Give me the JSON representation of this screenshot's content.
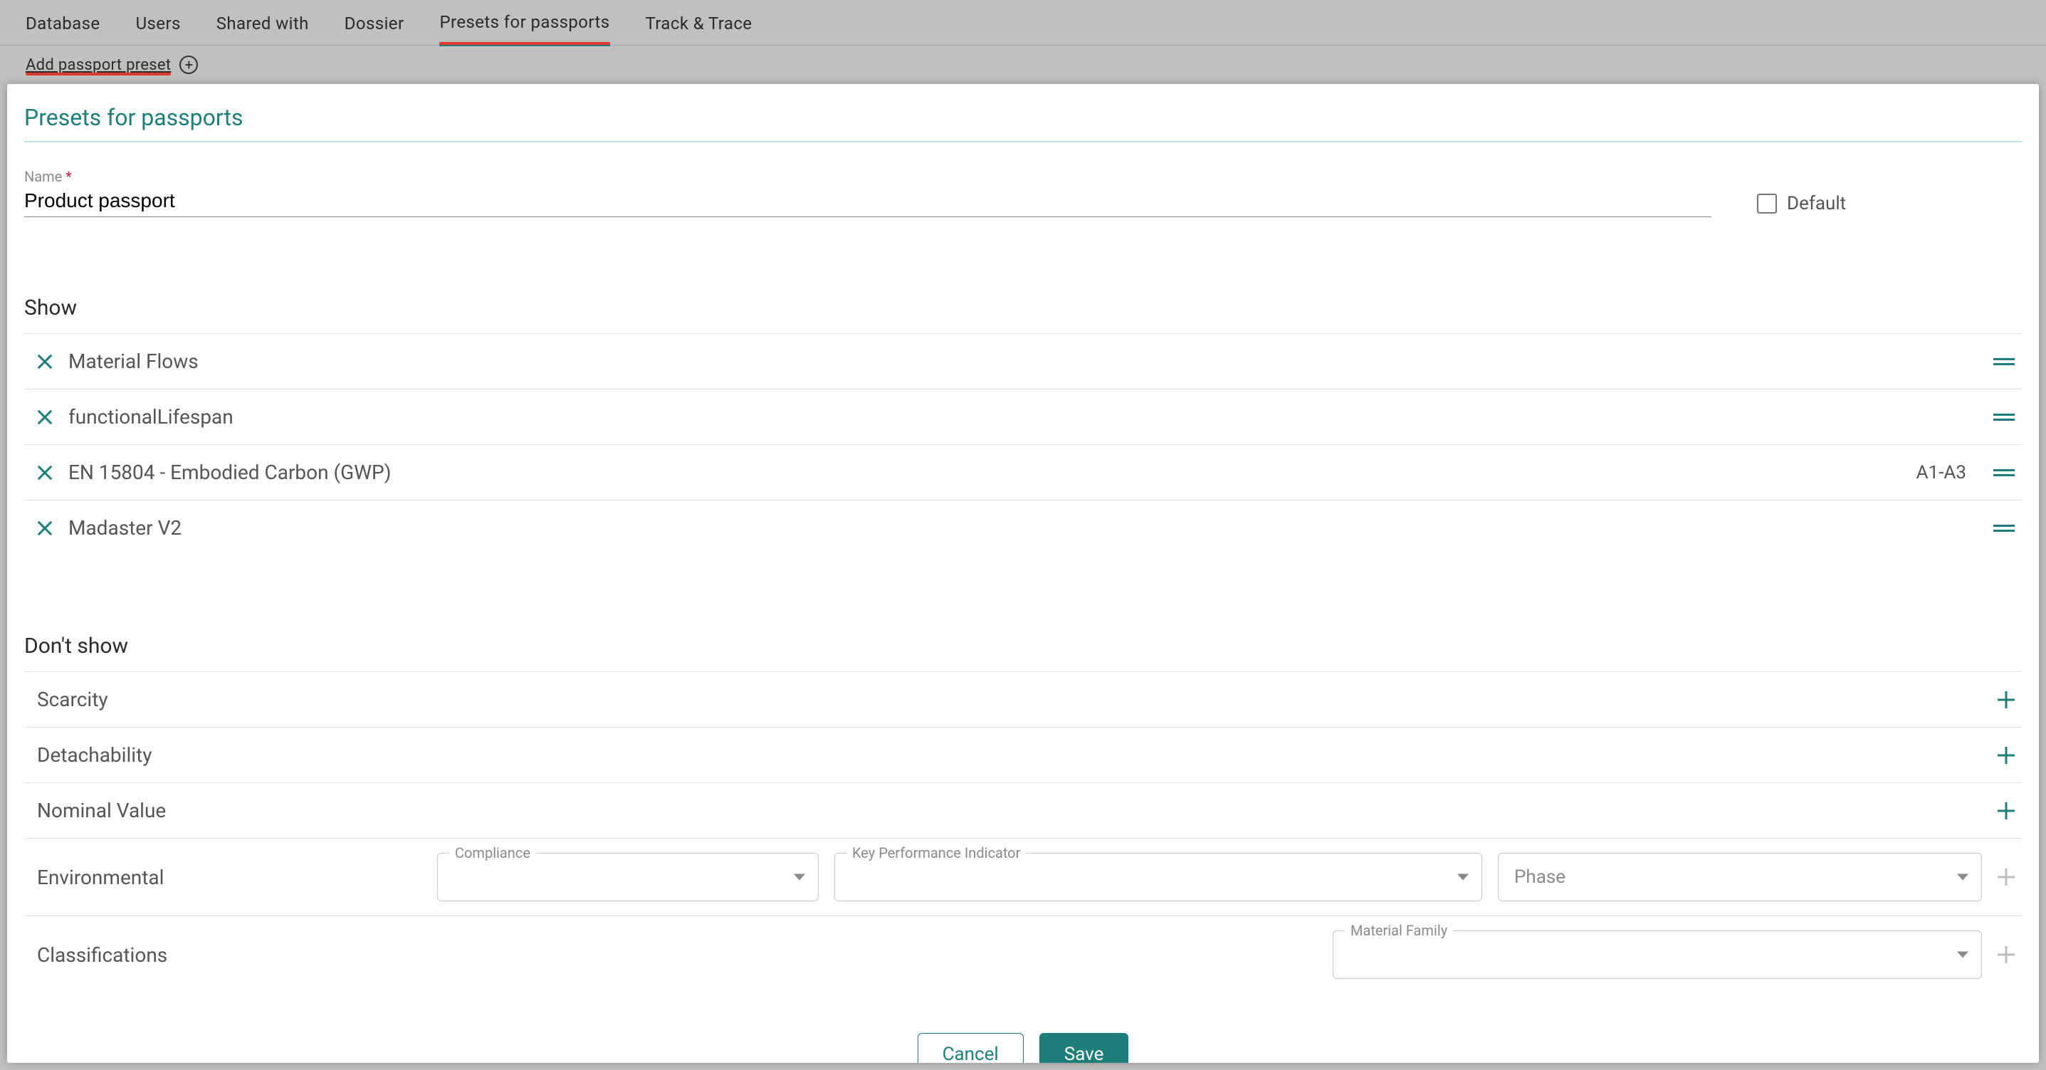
{
  "tabs": {
    "database": "Database",
    "users": "Users",
    "shared_with": "Shared with",
    "dossier": "Dossier",
    "presets": "Presets for passports",
    "track_trace": "Track & Trace"
  },
  "subbar": {
    "add_preset": "Add passport preset"
  },
  "modal": {
    "title": "Presets for passports",
    "name_label": "Name",
    "name_value": "Product passport",
    "default_label": "Default",
    "show_heading": "Show",
    "show_items": [
      {
        "label": "Material Flows",
        "badge": ""
      },
      {
        "label": "functionalLifespan",
        "badge": ""
      },
      {
        "label": "EN 15804 - Embodied Carbon (GWP)",
        "badge": "A1-A3"
      },
      {
        "label": "Madaster V2",
        "badge": ""
      }
    ],
    "dont_show_heading": "Don't show",
    "dont_show_items": [
      {
        "label": "Scarcity"
      },
      {
        "label": "Detachability"
      },
      {
        "label": "Nominal Value"
      }
    ],
    "env_row_label": "Environmental",
    "env_selects": {
      "compliance": "Compliance",
      "kpi": "Key Performance Indicator",
      "phase": "Phase",
      "phase_value": "Phase"
    },
    "class_row_label": "Classifications",
    "class_select": {
      "material_family": "Material Family"
    },
    "cancel": "Cancel",
    "save": "Save"
  }
}
